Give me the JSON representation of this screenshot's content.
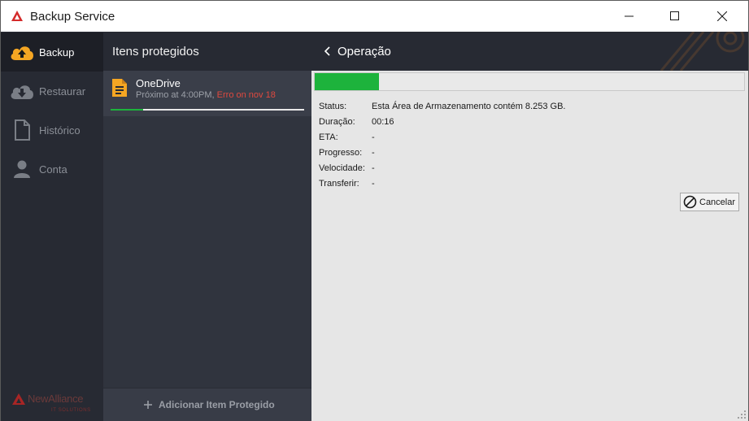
{
  "window": {
    "title": "Backup Service",
    "controls": [
      "minimize",
      "maximize",
      "close"
    ]
  },
  "nav": {
    "items": [
      {
        "label": "Backup",
        "icon": "cloud-upload-icon",
        "active": true
      },
      {
        "label": "Restaurar",
        "icon": "cloud-download-icon",
        "active": false
      },
      {
        "label": "Histórico",
        "icon": "document-icon",
        "active": false
      },
      {
        "label": "Conta",
        "icon": "user-icon",
        "active": false
      }
    ],
    "brand": {
      "name": "NewAlliance",
      "tagline": "IT SOLUTIONS"
    }
  },
  "protected": {
    "title": "Itens protegidos",
    "items": [
      {
        "name": "OneDrive",
        "next": "Próximo at 4:00PM, ",
        "error": "Erro on nov 18",
        "progress": 0.17
      }
    ],
    "add_label": "Adicionar Item Protegido"
  },
  "operation": {
    "back_icon": "chevron-left-icon",
    "title": "Operação",
    "progress": 0.15,
    "rows": [
      {
        "key": "Status:",
        "value": "Esta Área de Armazenamento contém 8.253 GB."
      },
      {
        "key": "Duração:",
        "value": "00:16"
      },
      {
        "key": "ETA:",
        "value": "-"
      },
      {
        "key": "Progresso:",
        "value": "-"
      },
      {
        "key": "Velocidade:",
        "value": "-"
      },
      {
        "key": "Transferir:",
        "value": "-"
      }
    ],
    "cancel_label": "Cancelar"
  },
  "colors": {
    "accent": "#1db33c",
    "error": "#e0493f",
    "backup_orange": "#f5a623",
    "brand_red": "#d42a2a"
  }
}
